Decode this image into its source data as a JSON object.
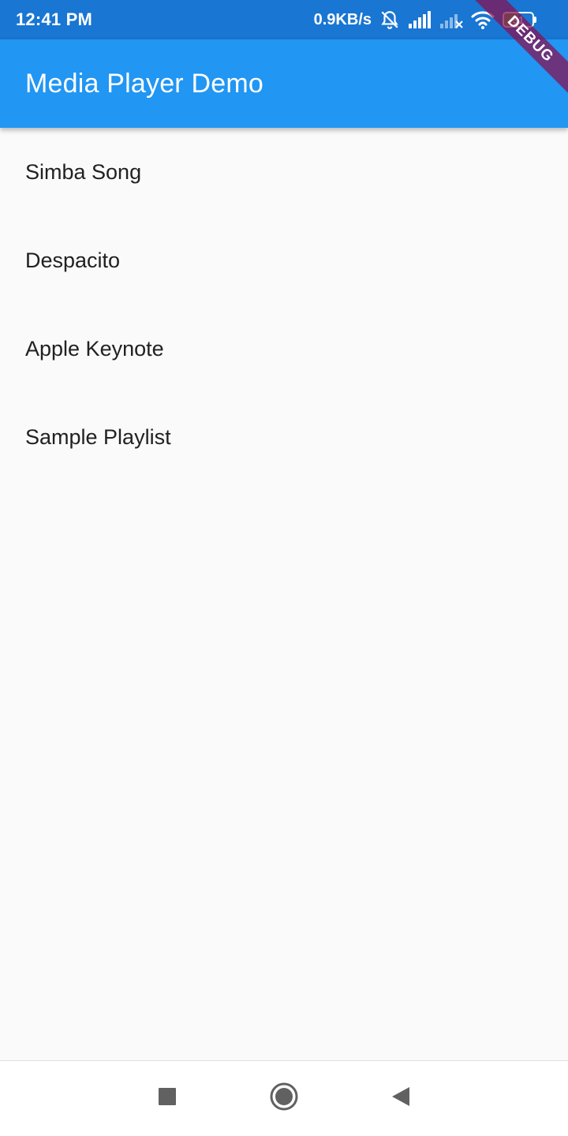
{
  "status_bar": {
    "time": "12:41 PM",
    "network_speed": "0.9KB/s",
    "battery_level": "51",
    "battery_fraction": 0.51,
    "icons": [
      "alarm-off-icon",
      "signal-icon",
      "signal-no-service-icon",
      "wifi-icon",
      "battery-icon"
    ]
  },
  "app_bar": {
    "title": "Media Player Demo",
    "color": "#2196f3"
  },
  "debug_banner": {
    "label": "DEBUG"
  },
  "media_list": {
    "items": [
      {
        "label": "Simba Song"
      },
      {
        "label": "Despacito"
      },
      {
        "label": "Apple Keynote"
      },
      {
        "label": "Sample Playlist"
      }
    ]
  },
  "nav_bar": {
    "buttons": [
      "recents-square-icon",
      "home-circle-icon",
      "back-triangle-icon"
    ]
  }
}
